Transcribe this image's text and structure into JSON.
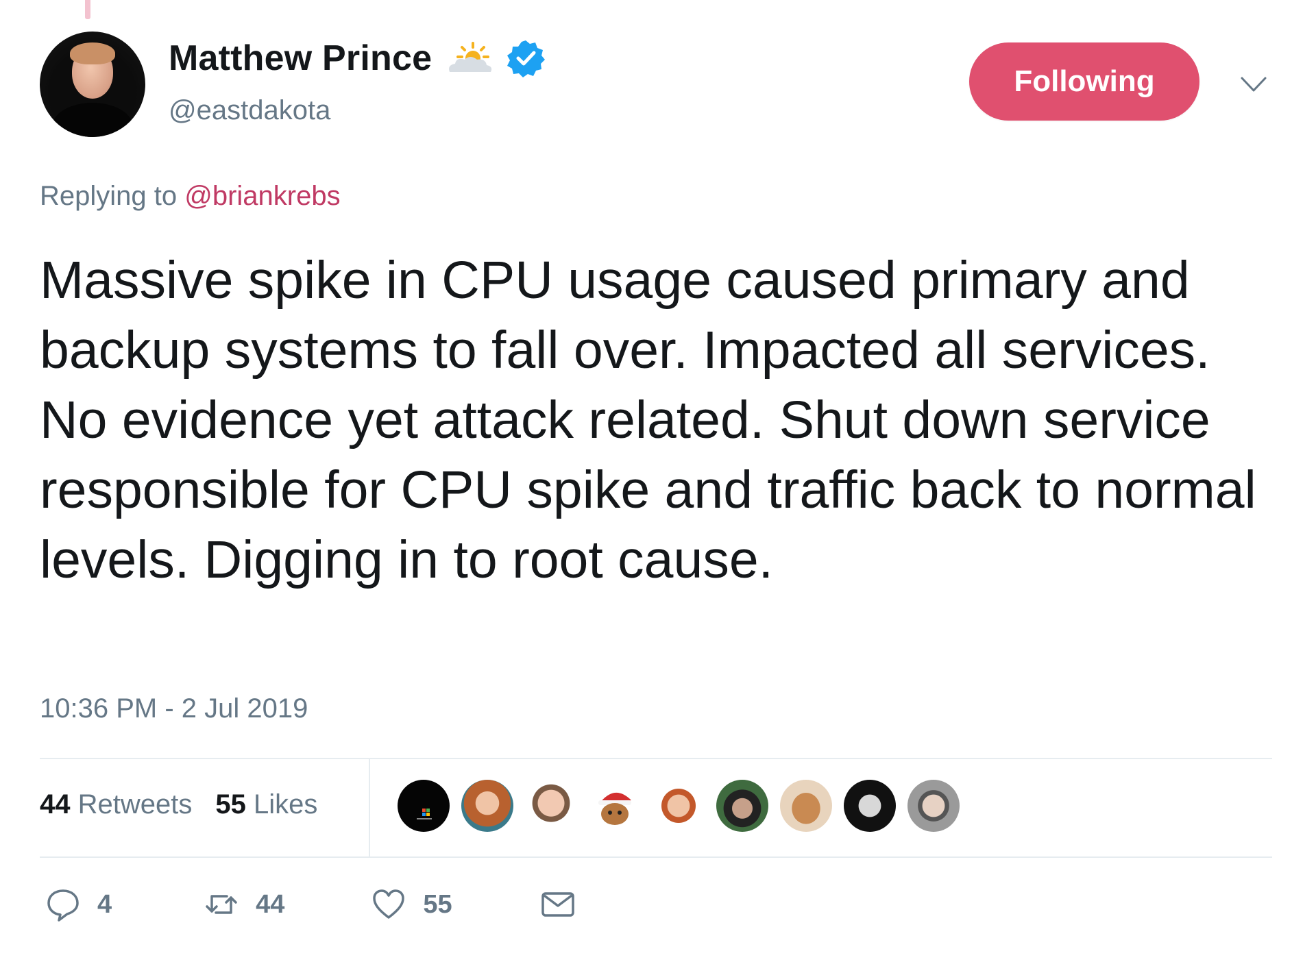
{
  "author": {
    "display_name": "Matthew Prince",
    "handle": "@eastdakota",
    "verified": true,
    "name_emoji_icon": "sun-behind-cloud-icon"
  },
  "follow_button": {
    "label": "Following",
    "color": "#e0506f"
  },
  "reply": {
    "prefix": "Replying to",
    "mention": "@briankrebs",
    "mention_color": "#c03a64"
  },
  "tweet": {
    "text": "Massive spike in CPU usage caused primary and backup systems to fall over. Impacted all services. No evidence yet attack related. Shut down service responsible for CPU spike and traffic back to normal levels. Digging in to root cause."
  },
  "timestamp": "10:36 PM - 2 Jul 2019",
  "stats": {
    "retweets_count": "44",
    "retweets_label": "Retweets",
    "likes_count": "55",
    "likes_label": "Likes"
  },
  "likers": [
    {
      "icon": "windows-logo-avatar"
    },
    {
      "icon": "woman-avatar"
    },
    {
      "icon": "man-glasses-avatar"
    },
    {
      "icon": "santa-cartoon-avatar"
    },
    {
      "icon": "man-red-hair-avatar"
    },
    {
      "icon": "man-hat-avatar"
    },
    {
      "icon": "dog-avatar"
    },
    {
      "icon": "man-dark-glasses-avatar"
    },
    {
      "icon": "man-grey-glasses-avatar"
    }
  ],
  "actions": {
    "replies": "4",
    "retweets": "44",
    "likes": "55"
  }
}
